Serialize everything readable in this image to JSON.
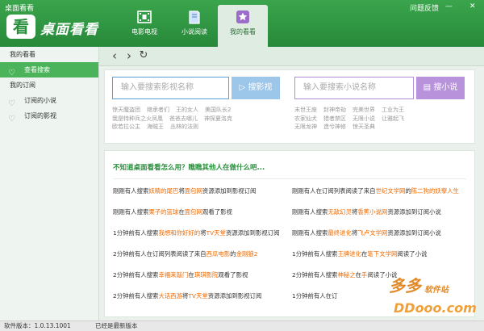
{
  "app": {
    "caption": "桌面看看",
    "logo_char": "看",
    "logo_text": "桌面看看"
  },
  "tabs": [
    {
      "label": "电影电视",
      "icon": "film-icon"
    },
    {
      "label": "小说阅读",
      "icon": "book-icon"
    },
    {
      "label": "我的看看",
      "icon": "star-icon"
    }
  ],
  "window": {
    "feedback": "问题反馈",
    "minimize": "—",
    "close": "✕"
  },
  "sidebar": {
    "head1": "我的看看",
    "item_search": "查看搜索",
    "head2": "我的订阅",
    "item_novel": "订阅的小说",
    "item_video": "订阅的影视"
  },
  "search": {
    "video_placeholder": "输入要搜索影视名称",
    "video_button": "搜影视",
    "novel_placeholder": "输入要搜索小说名称",
    "novel_button": "搜小说",
    "video_hot": [
      "惊天魔盗团",
      "继承者们",
      "王的女人",
      "美国队长2",
      "我是特种兵之火凤凰",
      "爸爸去哪儿",
      "神探夏洛克",
      "欧若拉公主",
      "海贼王",
      "丛林的法则"
    ],
    "novel_hot": [
      "末世王座",
      "封神帝劫",
      "完美世界",
      "工业为王",
      "农家仙犬",
      "猎者禁区",
      "无限小说",
      "让雅起飞",
      "无限龙神",
      "造兮神修",
      "惊天圣典"
    ]
  },
  "feed": {
    "title": "不知道桌面看看怎么用？瞧瞧其他人在做什么吧...",
    "left": [
      [
        "刚刚有人搜索",
        "妖精的尾巴",
        "将",
        "面包网",
        "资源添加到影视订阅"
      ],
      [
        "刚刚有人搜索",
        "栗子的篮球",
        "在",
        "面包网",
        "观看了影视"
      ],
      [
        "1分钟前有人搜索",
        "我想和你好好的",
        "将",
        "TV天堂",
        "资源添加到影视订阅"
      ],
      [
        "2分钟前有人在订阅列表阅读了来自",
        "西瓜电影",
        "的",
        "金刚狼2",
        ""
      ],
      [
        "2分钟前有人搜索",
        "幸福来敲门",
        "在",
        "琪琪影院",
        "观看了影视"
      ],
      [
        "2分钟前有人搜索",
        "大话西游",
        "将",
        "TV天堂",
        "资源添加到影视订阅"
      ]
    ],
    "right": [
      [
        "刚刚有人在订阅列表阅读了来自",
        "世纪文学网",
        "的",
        "陈二狗的妖孽人生",
        ""
      ],
      [
        "刚刚有人搜索",
        "无敌幻灵",
        "将",
        "香蕉小说网",
        "资源添加到订阅小说"
      ],
      [
        "刚刚有人搜索",
        "最终进化",
        "将",
        "飞卢文学网",
        "资源添加到订阅小说"
      ],
      [
        "1分钟前有人搜索",
        "王牌进化",
        "在",
        "笔下文学网",
        "阅读了小说"
      ],
      [
        "2分钟前有人搜索",
        "神秘之",
        "在",
        "手",
        "阅读了小说"
      ],
      [
        "1分钟前有人在订",
        "",
        "",
        "",
        ""
      ]
    ]
  },
  "status": {
    "version": "软件版本：1.0.13.1001",
    "latest": "已经是最新版本"
  },
  "watermark": {
    "cn": "多多",
    "site": "软件站",
    "url": "DDooo.com"
  }
}
